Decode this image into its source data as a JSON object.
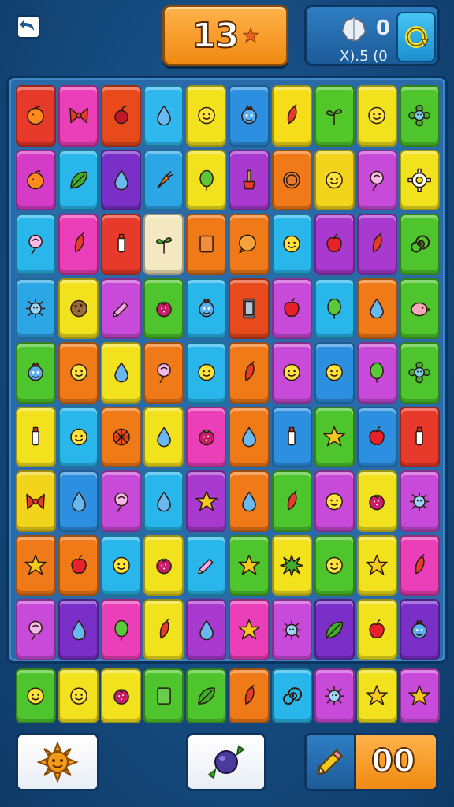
{
  "header": {
    "score": "13",
    "stats_top": "0",
    "stats_bottom": "X).5 (0",
    "icons": [
      "back-icon",
      "star-icon",
      "gem-icon",
      "refresh-icon"
    ]
  },
  "board": {
    "rows": [
      [
        {
          "c": "#e83a2a",
          "i": "orange"
        },
        {
          "c": "#ea3fb8",
          "i": "bow"
        },
        {
          "c": "#e84a1c",
          "i": "cherry"
        },
        {
          "c": "#2fb8ee",
          "i": "drop"
        },
        {
          "c": "#f2e21e",
          "i": "face"
        },
        {
          "c": "#2c8fe0",
          "i": "monster"
        },
        {
          "c": "#f6dd1a",
          "i": "pepper"
        },
        {
          "c": "#52c72a",
          "i": "sprout"
        },
        {
          "c": "#f2e21e",
          "i": "face"
        },
        {
          "c": "#4ec52c",
          "i": "flower"
        }
      ],
      [
        {
          "c": "#d43cc8",
          "i": "orange"
        },
        {
          "c": "#29b6ea",
          "i": "leaf"
        },
        {
          "c": "#7a2fc8",
          "i": "drop"
        },
        {
          "c": "#2da6e6",
          "i": "carrot"
        },
        {
          "c": "#f2e21e",
          "i": "balloon"
        },
        {
          "c": "#a83ad0",
          "i": "shovel"
        },
        {
          "c": "#f07a18",
          "i": "coin"
        },
        {
          "c": "#f2d41c",
          "i": "face"
        },
        {
          "c": "#c84ad8",
          "i": "lollipop"
        },
        {
          "c": "#f2e21e",
          "i": "gear"
        }
      ],
      [
        {
          "c": "#29b6ea",
          "i": "lollipop"
        },
        {
          "c": "#ea3fb8",
          "i": "pepper"
        },
        {
          "c": "#e83a2a",
          "i": "bottle"
        },
        {
          "c": "#f3e8c0",
          "i": "sprout"
        },
        {
          "c": "#f07a18",
          "i": "blank"
        },
        {
          "c": "#f07a18",
          "i": "bubble"
        },
        {
          "c": "#29b6ea",
          "i": "face"
        },
        {
          "c": "#a83ad0",
          "i": "apple"
        },
        {
          "c": "#a83ad0",
          "i": "pepper"
        },
        {
          "c": "#4ec52c",
          "i": "swirl"
        }
      ],
      [
        {
          "c": "#2da6e6",
          "i": "virus"
        },
        {
          "c": "#f2e21e",
          "i": "cookie"
        },
        {
          "c": "#c84ad8",
          "i": "pencil"
        },
        {
          "c": "#4ec52c",
          "i": "berry"
        },
        {
          "c": "#29b6ea",
          "i": "monster"
        },
        {
          "c": "#e84a1c",
          "i": "phone"
        },
        {
          "c": "#c84ad8",
          "i": "apple"
        },
        {
          "c": "#29b6ea",
          "i": "balloon"
        },
        {
          "c": "#f07a18",
          "i": "drop"
        },
        {
          "c": "#4ec52c",
          "i": "bird"
        }
      ],
      [
        {
          "c": "#4ec52c",
          "i": "monster"
        },
        {
          "c": "#f07a18",
          "i": "face"
        },
        {
          "c": "#f2e21e",
          "i": "drop"
        },
        {
          "c": "#f07a18",
          "i": "lollipop"
        },
        {
          "c": "#29b6ea",
          "i": "face"
        },
        {
          "c": "#f07a18",
          "i": "pepper"
        },
        {
          "c": "#c84ad8",
          "i": "face"
        },
        {
          "c": "#2c8fe0",
          "i": "face"
        },
        {
          "c": "#c84ad8",
          "i": "balloon"
        },
        {
          "c": "#4ec52c",
          "i": "flower"
        }
      ],
      [
        {
          "c": "#f2e21e",
          "i": "bottle"
        },
        {
          "c": "#29b6ea",
          "i": "face"
        },
        {
          "c": "#f07a18",
          "i": "wheel"
        },
        {
          "c": "#f2e21e",
          "i": "drop"
        },
        {
          "c": "#ea3fb8",
          "i": "berry"
        },
        {
          "c": "#f07a18",
          "i": "drop"
        },
        {
          "c": "#2c8fe0",
          "i": "bottle"
        },
        {
          "c": "#4ec52c",
          "i": "star"
        },
        {
          "c": "#2c8fe0",
          "i": "apple"
        },
        {
          "c": "#e83a2a",
          "i": "bottle"
        }
      ],
      [
        {
          "c": "#f2d41c",
          "i": "bow"
        },
        {
          "c": "#2c8fe0",
          "i": "drop"
        },
        {
          "c": "#c84ad8",
          "i": "lollipop"
        },
        {
          "c": "#29b6ea",
          "i": "drop"
        },
        {
          "c": "#a83ad0",
          "i": "star"
        },
        {
          "c": "#f07a18",
          "i": "drop"
        },
        {
          "c": "#4ec52c",
          "i": "pepper"
        },
        {
          "c": "#c84ad8",
          "i": "face"
        },
        {
          "c": "#f2e21e",
          "i": "berry"
        },
        {
          "c": "#c84ad8",
          "i": "virus"
        }
      ],
      [
        {
          "c": "#f07a18",
          "i": "star"
        },
        {
          "c": "#f07a18",
          "i": "apple"
        },
        {
          "c": "#29b6ea",
          "i": "face"
        },
        {
          "c": "#f2e21e",
          "i": "berry"
        },
        {
          "c": "#29b6ea",
          "i": "pencil"
        },
        {
          "c": "#4ec52c",
          "i": "star"
        },
        {
          "c": "#f2e21e",
          "i": "starburst"
        },
        {
          "c": "#4ec52c",
          "i": "face"
        },
        {
          "c": "#f2e21e",
          "i": "star"
        },
        {
          "c": "#ea3fb8",
          "i": "pepper"
        }
      ],
      [
        {
          "c": "#c84ad8",
          "i": "lollipop"
        },
        {
          "c": "#7a2fc8",
          "i": "drop"
        },
        {
          "c": "#ea3fb8",
          "i": "balloon"
        },
        {
          "c": "#f2e21e",
          "i": "pepper"
        },
        {
          "c": "#a83ad0",
          "i": "drop"
        },
        {
          "c": "#ea3fb8",
          "i": "star"
        },
        {
          "c": "#c84ad8",
          "i": "virus"
        },
        {
          "c": "#7a2fc8",
          "i": "leaf"
        },
        {
          "c": "#f2e21e",
          "i": "apple"
        },
        {
          "c": "#7a2fc8",
          "i": "monster"
        }
      ]
    ]
  },
  "tray": [
    {
      "c": "#4ec52c",
      "i": "face"
    },
    {
      "c": "#f2e21e",
      "i": "face"
    },
    {
      "c": "#f2e21e",
      "i": "berry"
    },
    {
      "c": "#4ec52c",
      "i": "blank"
    },
    {
      "c": "#4ec52c",
      "i": "leaf"
    },
    {
      "c": "#f07a18",
      "i": "pepper"
    },
    {
      "c": "#29b6ea",
      "i": "swirl"
    },
    {
      "c": "#c84ad8",
      "i": "virus"
    },
    {
      "c": "#f2e21e",
      "i": "star"
    },
    {
      "c": "#c84ad8",
      "i": "star"
    }
  ],
  "powerups": {
    "sun_icon": "sun-icon",
    "candy_icon": "candy-icon",
    "pencil_icon": "pencil-icon",
    "moves": "00"
  }
}
